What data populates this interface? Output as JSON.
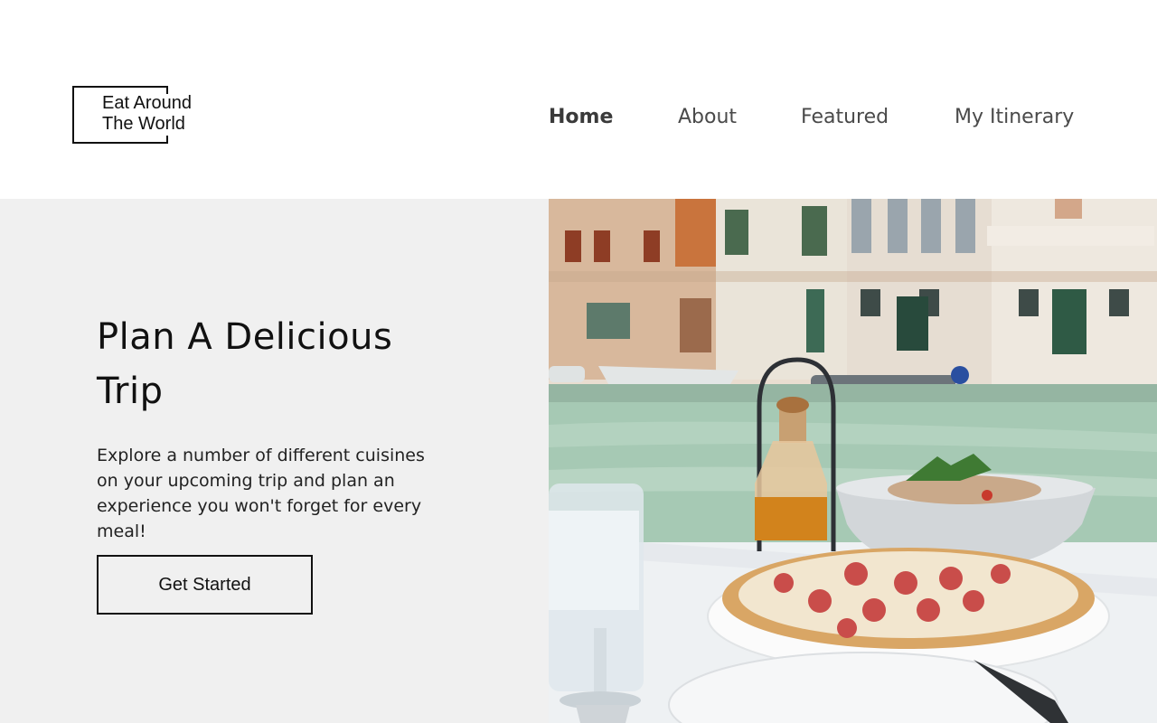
{
  "logo": {
    "line1": "Eat Around",
    "line2": "The World"
  },
  "nav": {
    "items": [
      {
        "label": "Home",
        "active": true
      },
      {
        "label": "About",
        "active": false
      },
      {
        "label": "Featured",
        "active": false
      },
      {
        "label": "My Itinerary",
        "active": false
      }
    ]
  },
  "hero": {
    "title_line1": "Plan A Delicious",
    "title_line2": "Trip",
    "body": "Explore a number of different cuisines on your upcoming trip and plan an experience you won't forget for every meal!",
    "cta_label": "Get Started"
  },
  "colors": {
    "hero_bg": "#f0f0f0",
    "text": "#111111",
    "nav_text": "#4a4a4a"
  }
}
